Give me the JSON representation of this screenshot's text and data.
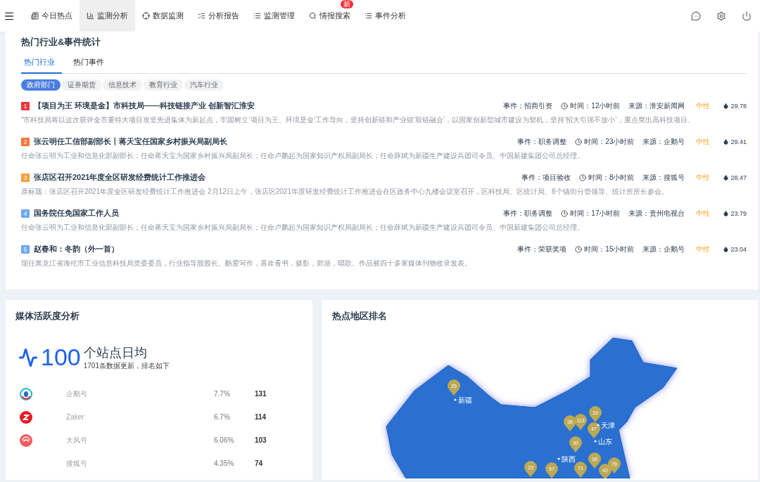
{
  "nav": {
    "items": [
      {
        "label": "今日热点",
        "selected": false
      },
      {
        "label": "监测分析",
        "selected": true
      },
      {
        "label": "数据监测",
        "selected": false
      },
      {
        "label": "分析报告",
        "selected": false
      },
      {
        "label": "监测管理",
        "selected": false
      },
      {
        "label": "情报搜索",
        "selected": false,
        "badge": "新"
      },
      {
        "label": "事件分析",
        "selected": false
      }
    ]
  },
  "hot": {
    "title": "热门行业&事件统计",
    "tabs": [
      {
        "label": "热门行业",
        "selected": true
      },
      {
        "label": "热门事件",
        "selected": false
      }
    ],
    "chips": [
      {
        "label": "政府部门",
        "selected": true
      },
      {
        "label": "证券期货",
        "selected": false
      },
      {
        "label": "信息技术",
        "selected": false
      },
      {
        "label": "教育行业",
        "selected": false
      },
      {
        "label": "汽车行业",
        "selected": false
      }
    ],
    "items": [
      {
        "rank": "1",
        "color": "#f0353d",
        "title": "【项目为王 环境是金】市科技局——科技链接产业 创新智汇淮安",
        "event": "事件：招商引资",
        "time": "时间：12小时前",
        "source": "来源：淮安新闻网",
        "sentiment": "中性",
        "heat": "29.78",
        "summary": "“市科技局将以这次获评全市重特大项目攻坚先进集体为新起点，牢固树立‘项目为王、环境是金’工作导向，坚持创新链和产业链‘双链融合’，以国家创新型城市建设为契机，坚持‘招大引强不放小’，重点突出高科技项目、"
      },
      {
        "rank": "2",
        "color": "#f7743a",
        "title": "张云明任工信部副部长丨蒋天宝任国家乡村振兴局副局长",
        "event": "事件：职务调整",
        "time": "时间：23小时前",
        "source": "来源：企鹅号",
        "sentiment": "中性",
        "heat": "29.41",
        "summary": "任命张云明为工业和信息化部副部长；任命蒋天宝为国家乡村振兴局副局长；任命卢鹏起为国家知识产权局副局长；任命薛斌为新疆生产建设兵团司令员、中国新建集团公司总经理。"
      },
      {
        "rank": "3",
        "color": "#f7a03a",
        "title": "张店区召开2021年度全区研发经费统计工作推进会",
        "event": "事件：项目验收",
        "time": "时间：8小时前",
        "source": "来源：搜狐号",
        "sentiment": "中性",
        "heat": "28.47",
        "summary": "原标题：张店区召开2021年度全区研发经费统计工作推进会 2月12日上午，张店区2021年度研发经费统计工作推进会在区政务中心九楼会议室召开，区科技局、区统计局、8个镇街分管领导、统计所所长参会。"
      },
      {
        "rank": "4",
        "color": "#6fa8ee",
        "title": "国务院任免国家工作人员",
        "event": "事件：职务调整",
        "time": "时间：17小时前",
        "source": "来源：贵州电视台",
        "sentiment": "中性",
        "heat": "23.79",
        "summary": "任命张云明为工业和信息化部副部长；任命蒋天宝为国家乡村振兴局副局长；任命卢鹏起为国家知识产权局副局长；任命薛斌为新疆生产建设兵团司令员、中国新建集团公司总经理。"
      },
      {
        "rank": "5",
        "color": "#6fa8ee",
        "title": "赵春和：冬韵（外一首）",
        "event": "事件：荣获奖项",
        "time": "时间：15小时前",
        "source": "来源：企鹅号",
        "sentiment": "中性",
        "heat": "23.04",
        "summary": "现任黑龙江省海伦市工业信息科技局党委委员，行业指导股股长。酷爱写作，喜欢看书，摄影，郊游，唱歌。作品被四十多家媒体刊物收录发表。"
      }
    ]
  },
  "media": {
    "title": "媒体活跃度分析",
    "big_number": "100",
    "headline": "个站点日均",
    "subline": "1701条数据更新，排名如下",
    "rows": [
      {
        "name": "企鹅号",
        "share": "7.7%",
        "count": "131"
      },
      {
        "name": "Zaker",
        "share": "6.7%",
        "count": "114"
      },
      {
        "name": "大风号",
        "share": "6.06%",
        "count": "103"
      },
      {
        "name": "搜狐号",
        "share": "4.35%",
        "count": "74"
      }
    ]
  },
  "regions": {
    "title": "热点地区排名",
    "pins": [
      {
        "value": "25"
      },
      {
        "value": "38"
      },
      {
        "value": "113"
      },
      {
        "value": "33"
      },
      {
        "value": "47"
      },
      {
        "value": "30"
      },
      {
        "value": "36"
      },
      {
        "value": "78"
      },
      {
        "value": "23"
      },
      {
        "value": "57"
      },
      {
        "value": "71"
      },
      {
        "value": "42"
      }
    ],
    "places": [
      {
        "name": "新疆"
      },
      {
        "name": "天津"
      },
      {
        "name": "山东"
      },
      {
        "name": "陕西"
      }
    ]
  }
}
